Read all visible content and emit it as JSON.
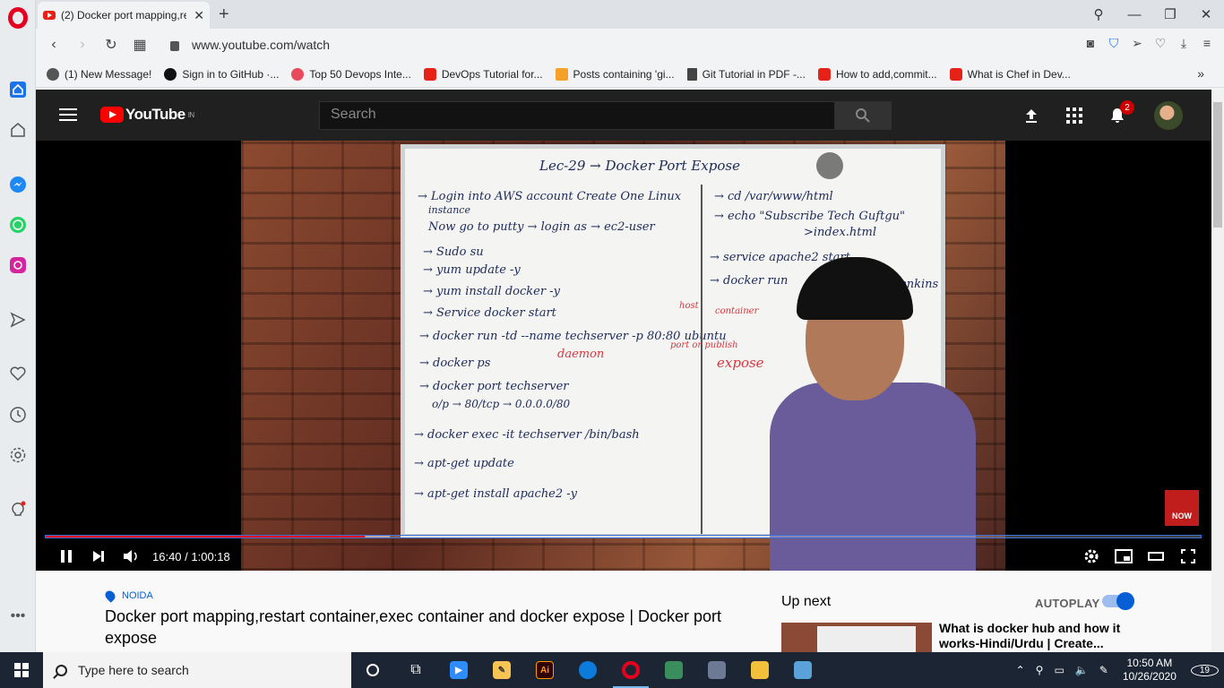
{
  "browser": {
    "tab_title": "(2) Docker port mapping,re",
    "url": "www.youtube.com/watch",
    "bookmarks": [
      {
        "label": "(1) New Message!",
        "color": "#555555"
      },
      {
        "label": "Sign in to GitHub ·...",
        "color": "#111111"
      },
      {
        "label": "Top 50 Devops Inte...",
        "color": "#e8495b"
      },
      {
        "label": "DevOps Tutorial for...",
        "color": "#e62117"
      },
      {
        "label": "Posts containing 'gi...",
        "color": "#f4a12a"
      },
      {
        "label": "Git Tutorial in PDF -...",
        "color": "#444444"
      },
      {
        "label": "How to add,commit...",
        "color": "#e62117"
      },
      {
        "label": "What is Chef in Dev...",
        "color": "#e62117"
      }
    ]
  },
  "youtube": {
    "logo_text": "YouTube",
    "logo_region": "IN",
    "search_placeholder": "Search",
    "notification_count": "2",
    "player": {
      "time": "16:40 / 1:00:18",
      "played_fraction": 0.276,
      "buffered_fraction": 0.298,
      "subscribe_label": "NOW"
    },
    "whiteboard": {
      "heading": "Lec-29 → Docker Port Expose",
      "left_lines": [
        "→ Login into AWS account Create One Linux",
        "instance",
        "Now go to putty → login as → ec2-user",
        "→ Sudo su",
        "→ yum update -y",
        "→ yum install docker -y",
        "→ Service docker start",
        "→ docker run -td --name techserver -p 80:80 ubuntu",
        "→ docker ps",
        "→ docker port techserver",
        "o/p → 80/tcp → 0.0.0.0/80",
        "→ docker exec -it techserver /bin/bash",
        "→ apt-get update",
        "→ apt-get install apache2 -y"
      ],
      "right_lines": [
        "→ cd /var/www/html",
        "→ echo \"Subscribe Tech Guftgu\"",
        ">index.html",
        "→ service apache2 start",
        "→ docker run",
        "jenkins"
      ],
      "red_notes": [
        "daemon",
        "expose",
        "host",
        "container",
        "port or publish"
      ]
    },
    "location": "NOIDA",
    "video_title": "Docker port mapping,restart container,exec container and docker expose | Docker port expose",
    "up_next_label": "Up next",
    "autoplay_label": "AUTOPLAY",
    "autoplay_on": true,
    "next_video_title": "What is docker hub and how it works-Hindi/Urdu | Create..."
  },
  "taskbar": {
    "search_placeholder": "Type here to search",
    "time": "10:50 AM",
    "date": "10/26/2020",
    "notification_count": "19"
  },
  "colors": {
    "youtube_red": "#ff0000",
    "youtube_header": "#202020",
    "link_blue": "#065fd4",
    "opera_red": "#e6001f"
  }
}
